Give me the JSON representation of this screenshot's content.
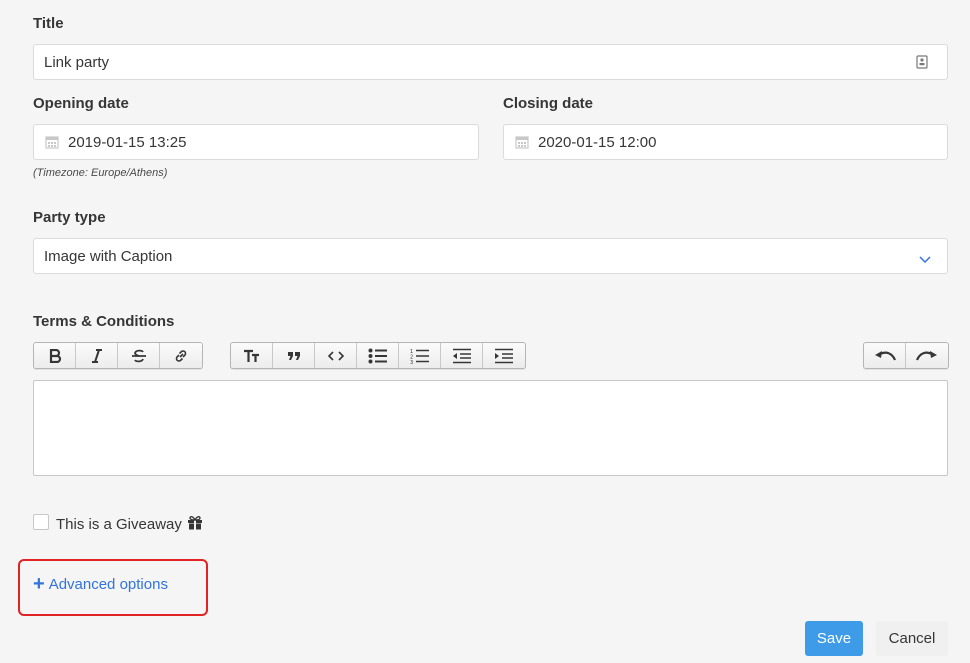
{
  "form": {
    "title_label": "Title",
    "title_value": "Link party",
    "opening_label": "Opening date",
    "opening_value": "2019-01-15 13:25",
    "closing_label": "Closing date",
    "closing_value": "2020-01-15 12:00",
    "timezone_hint": "(Timezone: Europe/Athens)",
    "party_type_label": "Party type",
    "party_type_value": "Image with Caption",
    "terms_label": "Terms & Conditions",
    "giveaway_label": "This is a Giveaway",
    "advanced_label": "Advanced options",
    "save_label": "Save",
    "cancel_label": "Cancel"
  },
  "toolbar": {
    "group1": [
      "bold-icon",
      "italic-icon",
      "strikethrough-icon",
      "link-icon"
    ],
    "group2": [
      "heading-icon",
      "quote-icon",
      "code-icon",
      "bullet-list-icon",
      "numbered-list-icon",
      "outdent-icon",
      "indent-icon"
    ],
    "group3": [
      "undo-icon",
      "redo-icon"
    ]
  },
  "colors": {
    "accent": "#3e9be8",
    "link": "#3273dc",
    "highlight": "#e02424"
  }
}
